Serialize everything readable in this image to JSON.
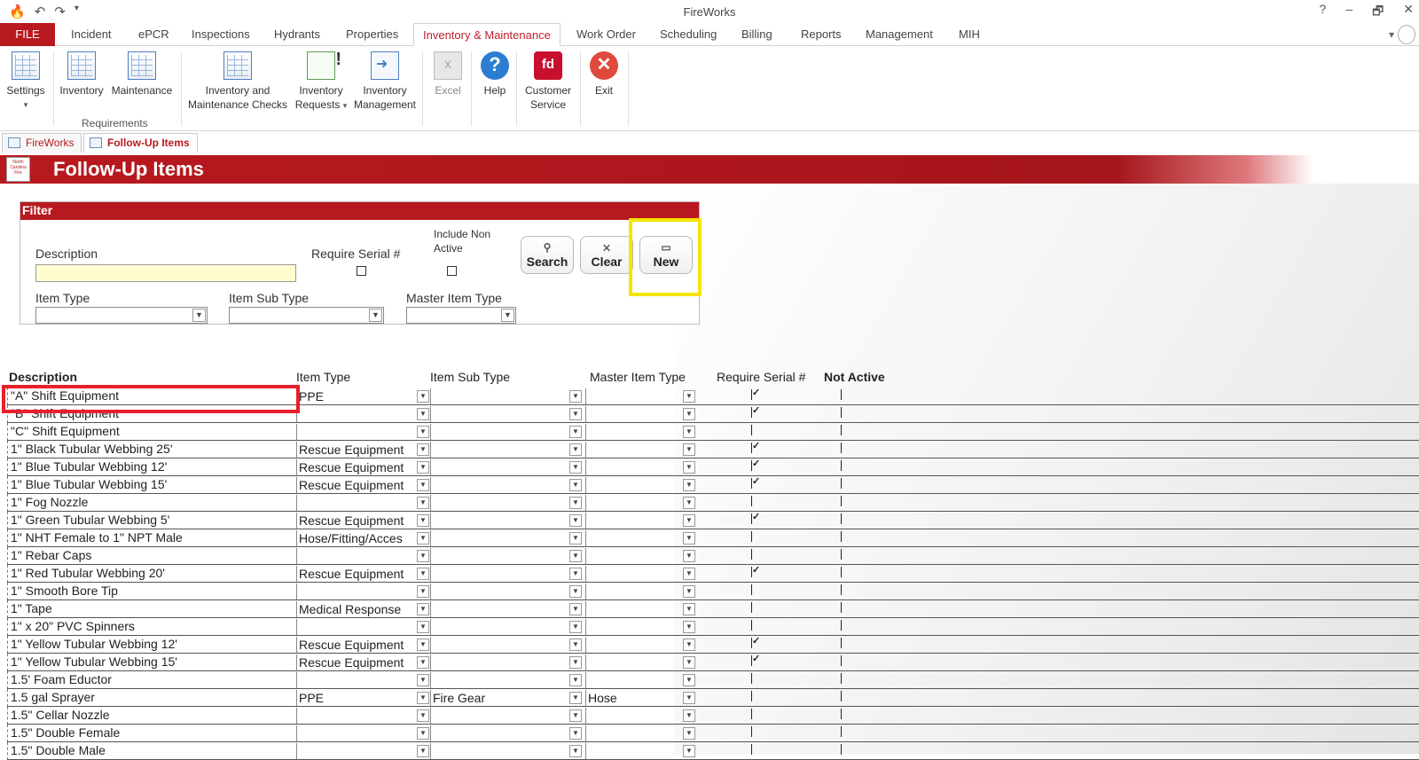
{
  "window": {
    "title": "FireWorks",
    "help": "?",
    "minimize": "–",
    "restore": "🗗",
    "close": "✕"
  },
  "ribbon_tabs": [
    "FILE",
    "Incident",
    "ePCR",
    "Inspections",
    "Hydrants",
    "Properties",
    "Inventory & Maintenance",
    "Work Order",
    "Scheduling",
    "Billing",
    "Reports",
    "Management",
    "MIH"
  ],
  "ribbon_buttons": {
    "settings": "Settings",
    "inventory": "Inventory",
    "maintenance": "Maintenance",
    "inv_checks_1": "Inventory and",
    "inv_checks_2": "Maintenance Checks",
    "inv_requests_1": "Inventory",
    "inv_requests_2": "Requests",
    "inv_mgmt_1": "Inventory",
    "inv_mgmt_2": "Management",
    "excel": "Excel",
    "help": "Help",
    "customer_1": "Customer",
    "customer_2": "Service",
    "exit": "Exit",
    "group_requirements": "Requirements"
  },
  "doc_tabs": [
    "FireWorks",
    "Follow-Up Items"
  ],
  "header": {
    "title": "Follow-Up Items"
  },
  "filter": {
    "title": "Filter",
    "description_label": "Description",
    "description_value": "",
    "require_serial_label": "Require Serial #",
    "include_non_active_1": "Include Non",
    "include_non_active_2": "Active",
    "item_type_label": "Item Type",
    "item_sub_type_label": "Item Sub Type",
    "master_item_type_label": "Master Item Type",
    "search_button": "Search",
    "clear_button": "Clear",
    "new_button": "New"
  },
  "grid": {
    "columns": [
      "Description",
      "Item Type",
      "Item Sub Type",
      "Master Item Type",
      "Require Serial #",
      "Not Active"
    ],
    "rows": [
      {
        "desc": "\"A\" Shift Equipment",
        "type": "PPE",
        "sub": "",
        "master": "",
        "serial": true
      },
      {
        "desc": "\"B\" Shift Equipment",
        "type": "",
        "sub": "",
        "master": "",
        "serial": true
      },
      {
        "desc": "\"C\" Shift Equipment",
        "type": "",
        "sub": "",
        "master": "",
        "serial": false
      },
      {
        "desc": "1\" Black Tubular Webbing 25'",
        "type": "Rescue Equipment",
        "sub": "",
        "master": "",
        "serial": true
      },
      {
        "desc": "1\" Blue Tubular Webbing 12'",
        "type": "Rescue Equipment",
        "sub": "",
        "master": "",
        "serial": true
      },
      {
        "desc": "1\" Blue Tubular Webbing 15'",
        "type": "Rescue Equipment",
        "sub": "",
        "master": "",
        "serial": true
      },
      {
        "desc": "1\" Fog Nozzle",
        "type": "",
        "sub": "",
        "master": "",
        "serial": false
      },
      {
        "desc": "1\" Green Tubular Webbing 5'",
        "type": "Rescue Equipment",
        "sub": "",
        "master": "",
        "serial": true
      },
      {
        "desc": "1\" NHT Female to 1\" NPT Male",
        "type": "Hose/Fitting/Acces",
        "sub": "",
        "master": "",
        "serial": false
      },
      {
        "desc": "1\" Rebar Caps",
        "type": "",
        "sub": "",
        "master": "",
        "serial": false
      },
      {
        "desc": "1\" Red Tubular Webbing 20'",
        "type": "Rescue Equipment",
        "sub": "",
        "master": "",
        "serial": true
      },
      {
        "desc": "1\" Smooth Bore Tip",
        "type": "",
        "sub": "",
        "master": "",
        "serial": false
      },
      {
        "desc": "1\" Tape",
        "type": "Medical Response",
        "sub": "",
        "master": "",
        "serial": false
      },
      {
        "desc": "1\" x 20\" PVC Spinners",
        "type": "",
        "sub": "",
        "master": "",
        "serial": false
      },
      {
        "desc": "1\" Yellow Tubular  Webbing 12'",
        "type": "Rescue Equipment",
        "sub": "",
        "master": "",
        "serial": true
      },
      {
        "desc": "1\" Yellow Tubular  Webbing 15'",
        "type": "Rescue Equipment",
        "sub": "",
        "master": "",
        "serial": true
      },
      {
        "desc": "1.5' Foam Eductor",
        "type": "",
        "sub": "",
        "master": "",
        "serial": false
      },
      {
        "desc": "1.5 gal Sprayer",
        "type": "PPE",
        "sub": "Fire Gear",
        "master": "Hose",
        "serial": false
      },
      {
        "desc": "1.5\" Cellar Nozzle",
        "type": "",
        "sub": "",
        "master": "",
        "serial": false
      },
      {
        "desc": "1.5\" Double Female",
        "type": "",
        "sub": "",
        "master": "",
        "serial": false
      },
      {
        "desc": "1.5\" Double Male",
        "type": "",
        "sub": "",
        "master": "",
        "serial": false
      }
    ]
  },
  "colors": {
    "brand_red": "#b8191f",
    "highlight_yellow": "#f4e600",
    "highlight_red": "#e8202a"
  }
}
